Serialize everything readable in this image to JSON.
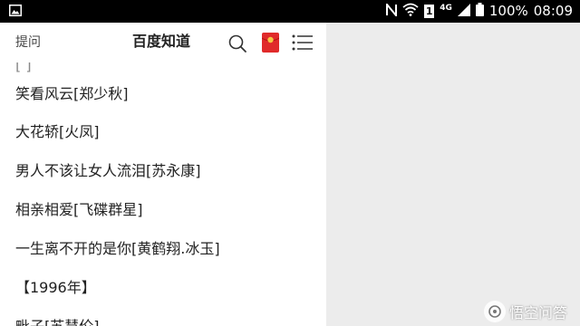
{
  "status_bar": {
    "battery": "100%",
    "time": "08:09",
    "sim": "1",
    "network": "4G"
  },
  "header": {
    "ask_label": "提问",
    "title": "百度知道",
    "icons": [
      "search-icon",
      "red-packet-icon",
      "menu-icon"
    ]
  },
  "content": {
    "partial_top": "[ ]",
    "lines": [
      "笑看风云[郑少秋]",
      "大花轿[火凤]",
      "男人不该让女人流泪[苏永康]",
      "相亲相爱[飞碟群星]",
      "一生离不开的是你[黄鹤翔.冰玉]",
      "【1996年】",
      "毗子[苏慧伦]"
    ]
  },
  "watermark": {
    "text": "悟空问答"
  },
  "colors": {
    "accent": "#e02a2a",
    "status_bar": "#000000",
    "right_panel": "#ececec"
  }
}
